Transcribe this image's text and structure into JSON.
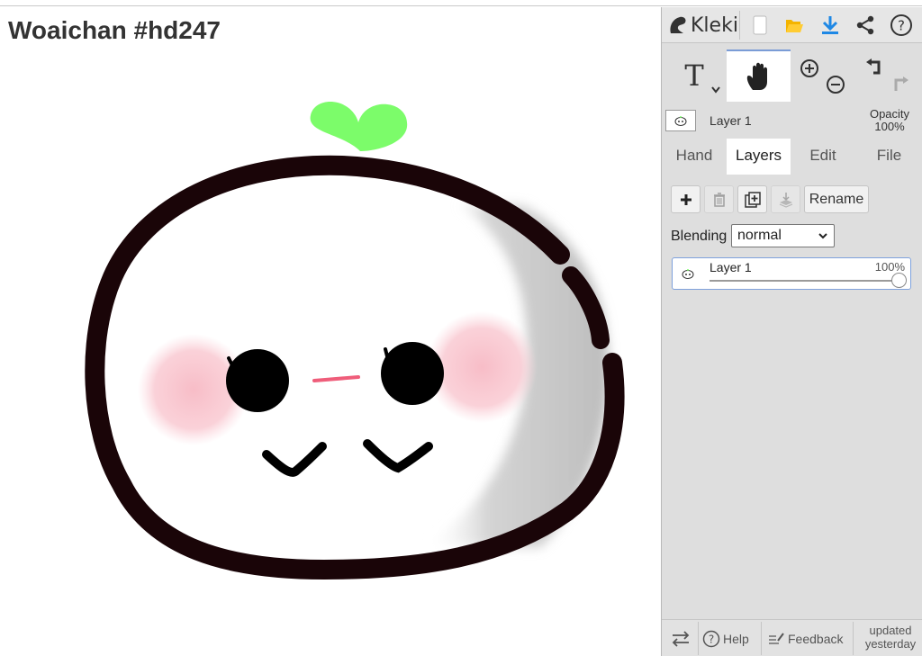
{
  "canvas": {
    "title": "Woaichan #hd247"
  },
  "app": {
    "name": "Kleki"
  },
  "topbar": {
    "icons": [
      "kleki-logo-icon",
      "new-file-icon",
      "open-folder-icon",
      "download-icon",
      "share-icon",
      "help-icon"
    ],
    "accent": "#1e88e5",
    "folder_color": "#f4b400"
  },
  "tools": {
    "text_label": "T",
    "active": "hand"
  },
  "layer_header": {
    "name": "Layer 1",
    "opacity_label": "Opacity",
    "opacity_value": "100%"
  },
  "tabs": [
    {
      "label": "Hand"
    },
    {
      "label": "Layers"
    },
    {
      "label": "Edit"
    },
    {
      "label": "File"
    }
  ],
  "layers_panel": {
    "rename_label": "Rename",
    "blending_label": "Blending",
    "blending_value": "normal",
    "layers": [
      {
        "name": "Layer 1",
        "opacity": "100%",
        "opacity_fraction": 1.0
      }
    ]
  },
  "bottombar": {
    "help_label": "Help",
    "feedback_label": "Feedback",
    "updated_line1": "updated",
    "updated_line2": "yesterday"
  }
}
